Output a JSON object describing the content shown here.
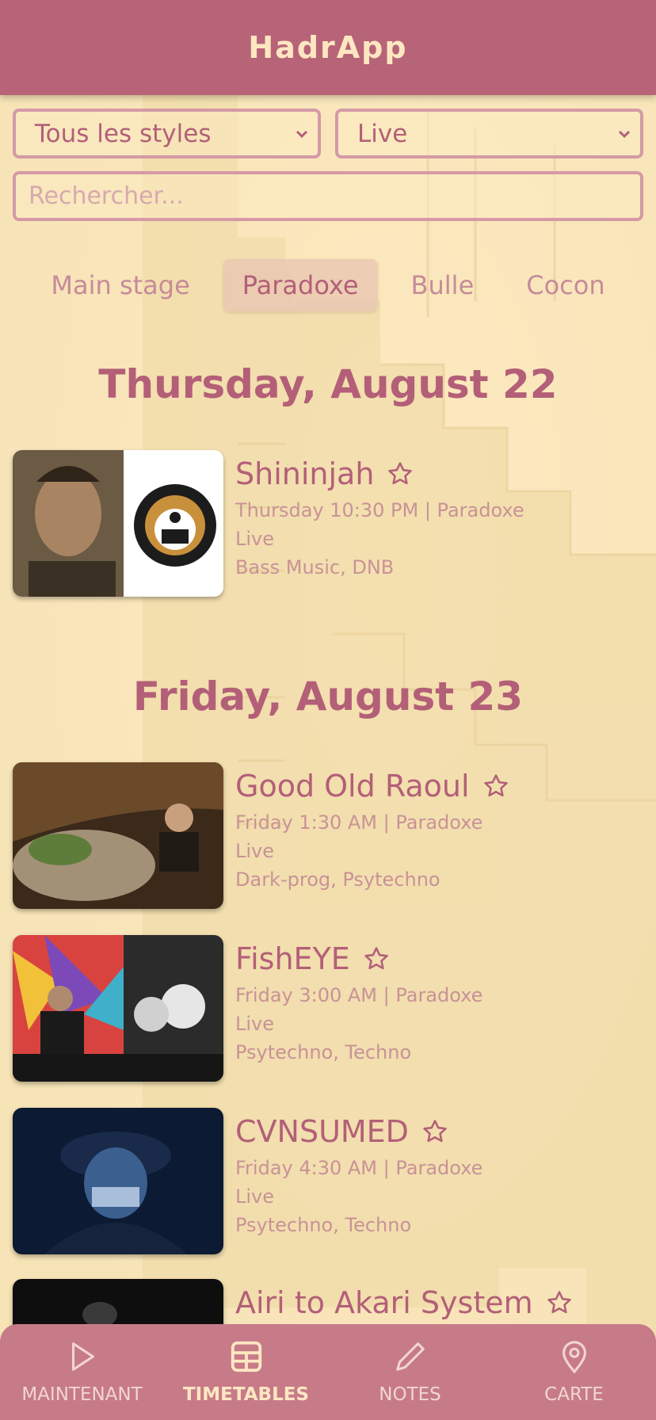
{
  "app": {
    "title": "HadrApp"
  },
  "filters": {
    "style_select": "Tous les styles",
    "type_select": "Live",
    "search_placeholder": "Rechercher..."
  },
  "tabs": [
    {
      "label": "Main stage",
      "active": false
    },
    {
      "label": "Paradoxe",
      "active": true
    },
    {
      "label": "Bulle",
      "active": false
    },
    {
      "label": "Cocon",
      "active": false
    }
  ],
  "days": [
    {
      "heading": "Thursday, August 22",
      "acts": [
        {
          "name": "Shininjah",
          "time": "Thursday 10:30 PM | Paradoxe",
          "type": "Live",
          "styles": "Bass Music, DNB",
          "favorite_icon": "star-outline-icon"
        }
      ]
    },
    {
      "heading": "Friday, August 23",
      "acts": [
        {
          "name": "Good Old Raoul",
          "time": "Friday 1:30 AM | Paradoxe",
          "type": "Live",
          "styles": "Dark-prog, Psytechno",
          "favorite_icon": "star-outline-icon"
        },
        {
          "name": "FishEYE",
          "time": "Friday 3:00 AM | Paradoxe",
          "type": "Live",
          "styles": "Psytechno, Techno",
          "favorite_icon": "star-outline-icon"
        },
        {
          "name": "CVNSUMED",
          "time": "Friday 4:30 AM | Paradoxe",
          "type": "Live",
          "styles": "Psytechno, Techno",
          "favorite_icon": "star-outline-icon"
        },
        {
          "name": "Airi to Akari System",
          "favorite_icon": "star-outline-icon"
        }
      ]
    }
  ],
  "nav": [
    {
      "label": "MAINTENANT",
      "icon": "play-icon",
      "active": false
    },
    {
      "label": "TIMETABLES",
      "icon": "table-icon",
      "active": true
    },
    {
      "label": "NOTES",
      "icon": "pencil-icon",
      "active": false
    },
    {
      "label": "CARTE",
      "icon": "map-pin-icon",
      "active": false
    }
  ],
  "colors": {
    "header": "#b86478",
    "background": "#fcecc2",
    "accent": "#b35f78",
    "nav_background": "#c77b89",
    "nav_active_label": "#fde7c2"
  }
}
